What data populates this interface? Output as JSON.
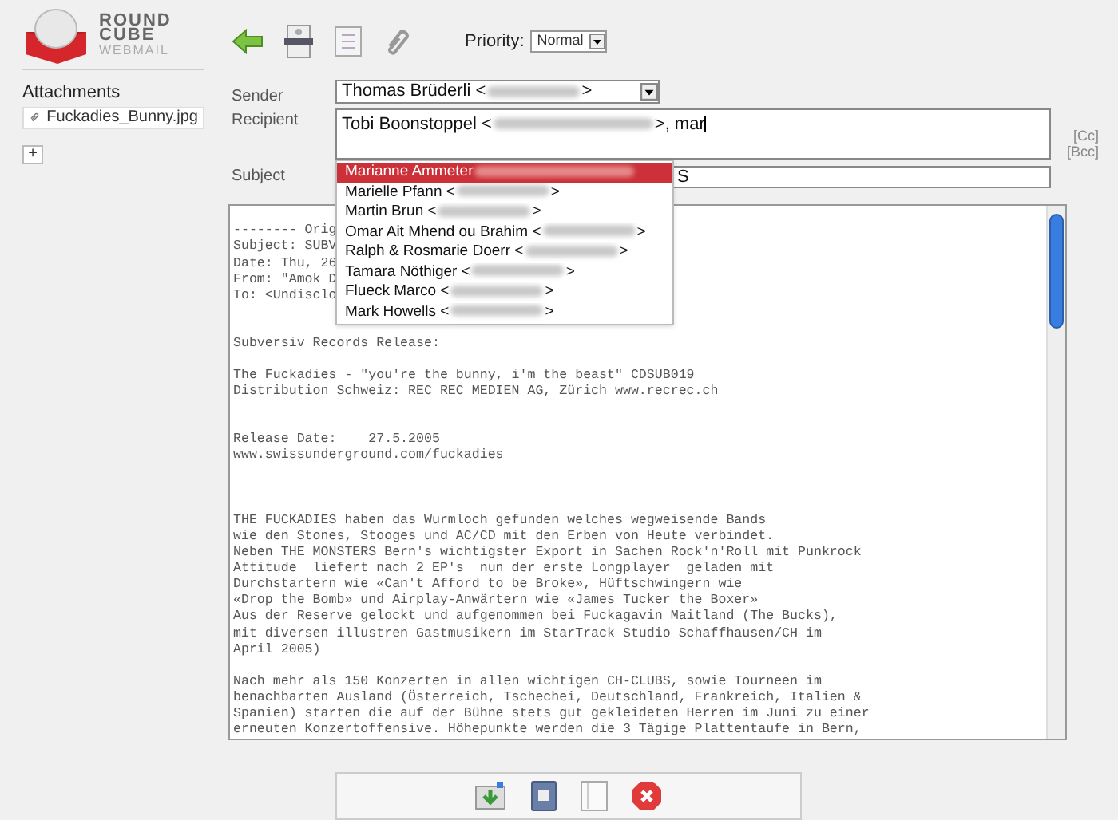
{
  "logo": {
    "line_1": "ROUND",
    "line_2": "CUBE",
    "line_3": "WEBMAIL"
  },
  "attachments": {
    "title": "Attachments",
    "files": [
      "Fuckadies_Bunny.jpg"
    ],
    "add_label": "+"
  },
  "toolbar": {
    "priority_label": "Priority:",
    "priority_value": "Normal"
  },
  "form": {
    "sender_label": "Sender",
    "sender_name": "Thomas Brüderli <",
    "sender_close": ">",
    "recipient_label": "Recipient",
    "recipient_name": "Tobi Boonstoppel <",
    "recipient_rest": ">, mar",
    "cc": "[Cc]",
    "bcc": "[Bcc]",
    "subject_label": "Subject",
    "subject_value": "S"
  },
  "suggestions": [
    {
      "name": "Marianne Ammeter",
      "selected": true
    },
    {
      "name": "Marielle Pfann <",
      "close": ">",
      "selected": false
    },
    {
      "name": "Martin Brun <",
      "close": ">",
      "selected": false
    },
    {
      "name": "Omar Ait Mhend ou Brahim <",
      "close": ">",
      "selected": false
    },
    {
      "name": "Ralph & Rosmarie Doerr <",
      "close": ">",
      "selected": false
    },
    {
      "name": "Tamara Nöthiger <",
      "close": ">",
      "selected": false
    },
    {
      "name": "Flueck Marco <",
      "close": ">",
      "selected": false
    },
    {
      "name": "Mark Howells <",
      "close": ">",
      "selected": false
    }
  ],
  "body": {
    "header": "-------- Orig\nSubject: SUBV\nDate: Thu, 26\nFrom: \"Amok D\nTo: <Undisclo",
    "text": "Subversiv Records Release:\n\nThe Fuckadies - \"you're the bunny, i'm the beast\" CDSUB019\nDistribution Schweiz: REC REC MEDIEN AG, Zürich www.recrec.ch\n\n\nRelease Date:    27.5.2005\nwww.swissunderground.com/fuckadies\n\n\n\nTHE FUCKADIES haben das Wurmloch gefunden welches wegweisende Bands\nwie den Stones, Stooges und AC/CD mit den Erben von Heute verbindet.\nNeben THE MONSTERS Bern's wichtigster Export in Sachen Rock'n'Roll mit Punkrock\nAttitude  liefert nach 2 EP's  nun der erste Longplayer  geladen mit\nDurchstartern wie «Can't Afford to be Broke», Hüftschwingern wie\n«Drop the Bomb» und Airplay-Anwärtern wie «James Tucker the Boxer»\nAus der Reserve gelockt und aufgenommen bei Fuckagavin Maitland (The Bucks),\nmit diversen illustren Gastmusikern im StarTrack Studio Schaffhausen/CH im\nApril 2005)\n\nNach mehr als 150 Konzerten in allen wichtigen CH-CLUBS, sowie Tourneen im\nbenachbarten Ausland (Österreich, Tschechei, Deutschland, Frankreich, Italien &\nSpanien) starten die auf der Bühne stets gut gekleideten Herren im Juni zu einer\nerneuten Konzertoffensive. Höhepunkte werden die 3 Tägige Plattentaufe in Bern,"
  }
}
